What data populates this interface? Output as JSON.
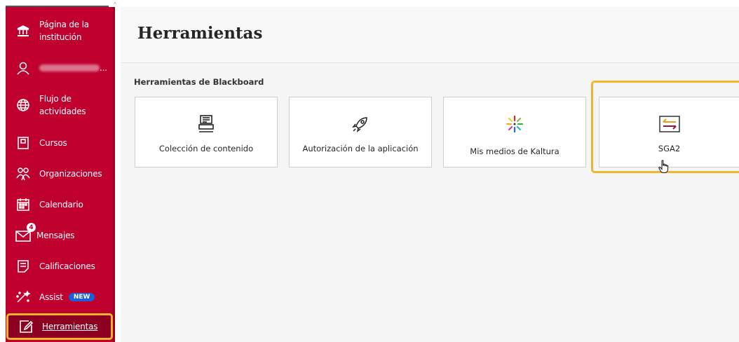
{
  "sidebar": {
    "items": [
      {
        "label": "Página de la institución",
        "icon": "institution-icon"
      },
      {
        "label": "",
        "icon": "user-icon",
        "suffix": "..."
      },
      {
        "label": "Flujo de actividades",
        "icon": "globe-icon"
      },
      {
        "label": "Cursos",
        "icon": "courses-icon"
      },
      {
        "label": "Organizaciones",
        "icon": "organizations-icon"
      },
      {
        "label": "Calendario",
        "icon": "calendar-icon"
      },
      {
        "label": "Mensajes",
        "icon": "mail-icon",
        "badge": "4"
      },
      {
        "label": "Calificaciones",
        "icon": "grades-icon"
      },
      {
        "label": "Assist",
        "icon": "assist-icon",
        "badge": "NEW"
      },
      {
        "label": "Herramientas",
        "icon": "tools-icon"
      }
    ]
  },
  "main": {
    "title": "Herramientas",
    "section_title": "Herramientas de Blackboard",
    "cards": [
      {
        "label": "Colección de contenido",
        "icon": "content-collection-icon"
      },
      {
        "label": "Autorización de la aplicación",
        "icon": "rocket-icon"
      },
      {
        "label": "Mis medios de Kaltura",
        "icon": "kaltura-icon"
      },
      {
        "label": "SGA2",
        "icon": "swap-arrows-icon"
      }
    ]
  },
  "colors": {
    "sidebar": "#c0002f",
    "active": "#8c0020",
    "highlight": "#f2b52c",
    "badge_new": "#1b5fd9"
  }
}
